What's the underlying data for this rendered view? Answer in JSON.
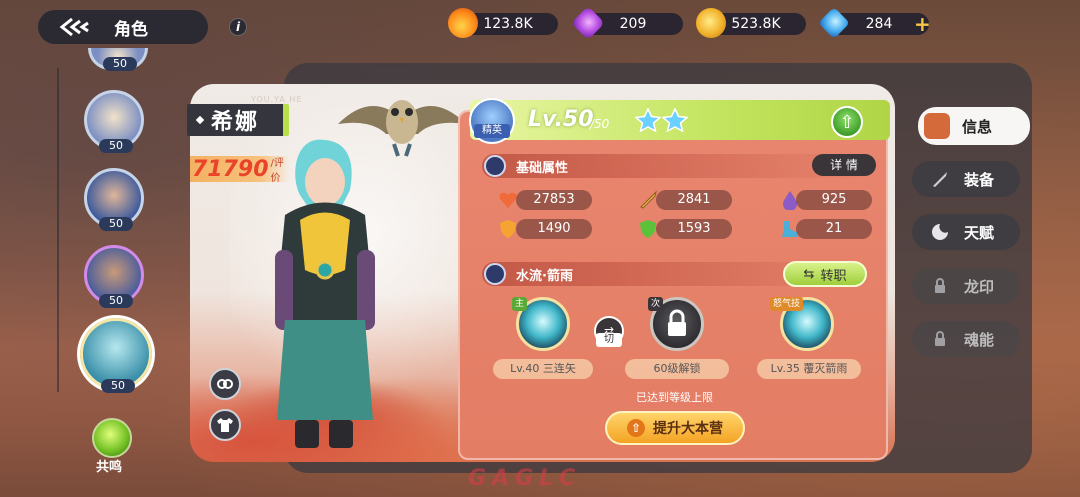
{
  "header": {
    "title": "角色",
    "info_icon": "i"
  },
  "currencies": [
    {
      "icon": "fire-token-icon",
      "value": "123.8K"
    },
    {
      "icon": "purple-crystal-icon",
      "value": "209"
    },
    {
      "icon": "gold-coin-icon",
      "value": "523.8K"
    },
    {
      "icon": "blue-gem-icon",
      "value": "284"
    }
  ],
  "roster": {
    "levels": [
      "50",
      "50",
      "50",
      "50",
      "50"
    ],
    "resonance_label": "共鸣"
  },
  "character": {
    "name": "希娜",
    "name_sub": "YOU.YA HE",
    "rating_value": "71790",
    "rating_label": "/评价",
    "rank_label": "精英",
    "level": "Lv.50",
    "level_max": "/50",
    "stars": 2
  },
  "attributes": {
    "title": "基础属性",
    "detail_label": "详 情",
    "stats": [
      {
        "icon": "heart-icon",
        "value": "27853"
      },
      {
        "icon": "sword-icon",
        "value": "2841"
      },
      {
        "icon": "drop-icon",
        "value": "925"
      },
      {
        "icon": "shield-orange-icon",
        "value": "1490"
      },
      {
        "icon": "shield-green-icon",
        "value": "1593"
      },
      {
        "icon": "boot-icon",
        "value": "21"
      }
    ]
  },
  "class": {
    "title": "水流·箭雨",
    "job_change_label": "转职"
  },
  "skills": [
    {
      "tag": "主",
      "label": "Lv.40 三连矢",
      "locked": false
    },
    {
      "tag": "次",
      "label": "60级解锁",
      "locked": true
    },
    {
      "tag": "怒气技",
      "label": "Lv.35 覆灭箭雨",
      "locked": false
    }
  ],
  "switch_label": "切",
  "max_level_note": "已达到等级上限",
  "upgrade_button": "提升大本营",
  "tabs": [
    {
      "label": "信息",
      "state": "active"
    },
    {
      "label": "装备",
      "state": "normal"
    },
    {
      "label": "天赋",
      "state": "normal"
    },
    {
      "label": "龙印",
      "state": "disabled"
    },
    {
      "label": "魂能",
      "state": "disabled"
    }
  ],
  "watermark": "GAGLC",
  "colors": {
    "level_bar": "#c2e45e",
    "panel": "#e37d64",
    "rating": "#e9432a",
    "upgrade": "#f4a324"
  }
}
